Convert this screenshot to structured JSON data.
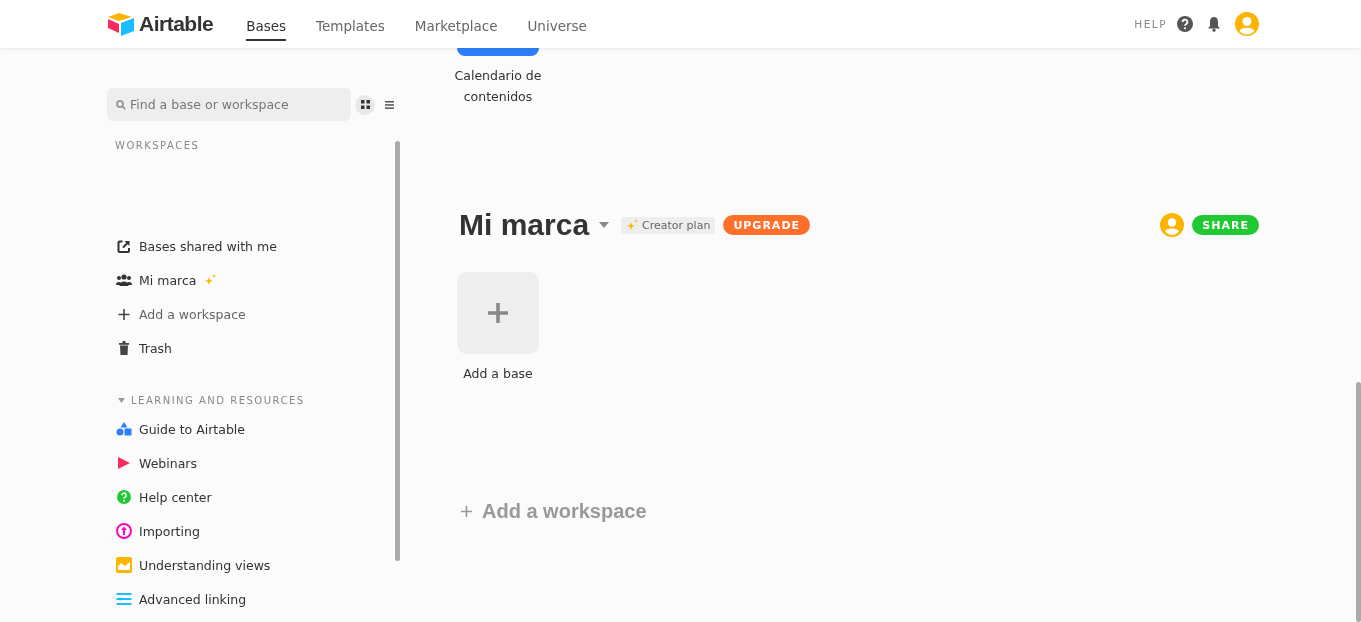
{
  "header": {
    "logo": "Airtable",
    "tabs": [
      {
        "label": "Bases",
        "selected": true
      },
      {
        "label": "Templates",
        "selected": false
      },
      {
        "label": "Marketplace",
        "selected": false
      },
      {
        "label": "Universe",
        "selected": false
      }
    ],
    "help": "HELP"
  },
  "sidebar": {
    "search": {
      "placeholder": "Find a base or workspace"
    },
    "grid_view_selected": true,
    "workspaces_heading": "WORKSPACES",
    "items": [
      {
        "kind": "shared",
        "label": "Bases shared with me"
      },
      {
        "kind": "workspace",
        "label": "Mi marca"
      },
      {
        "kind": "add",
        "label": "Add a workspace"
      },
      {
        "kind": "trash",
        "label": "Trash"
      }
    ],
    "learning": {
      "heading": "LEARNING AND RESOURCES",
      "expanded": true,
      "items": [
        {
          "kind": "guide",
          "label": "Guide to Airtable"
        },
        {
          "kind": "webinar",
          "label": "Webinars"
        },
        {
          "kind": "help",
          "label": "Help center"
        },
        {
          "kind": "import",
          "label": "Importing"
        },
        {
          "kind": "views",
          "label": "Understanding views"
        },
        {
          "kind": "linking",
          "label": "Advanced linking"
        }
      ]
    }
  },
  "previous_bases": [
    {
      "name": "Calendario de contenidos",
      "color": "#2d7ff9"
    }
  ],
  "workspace": {
    "title": "Mi marca",
    "plan": "Creator plan",
    "upgrade": "UPGRADE",
    "share": "SHARE",
    "add_base": "Add a base"
  },
  "add_workspace": "Add a workspace"
}
